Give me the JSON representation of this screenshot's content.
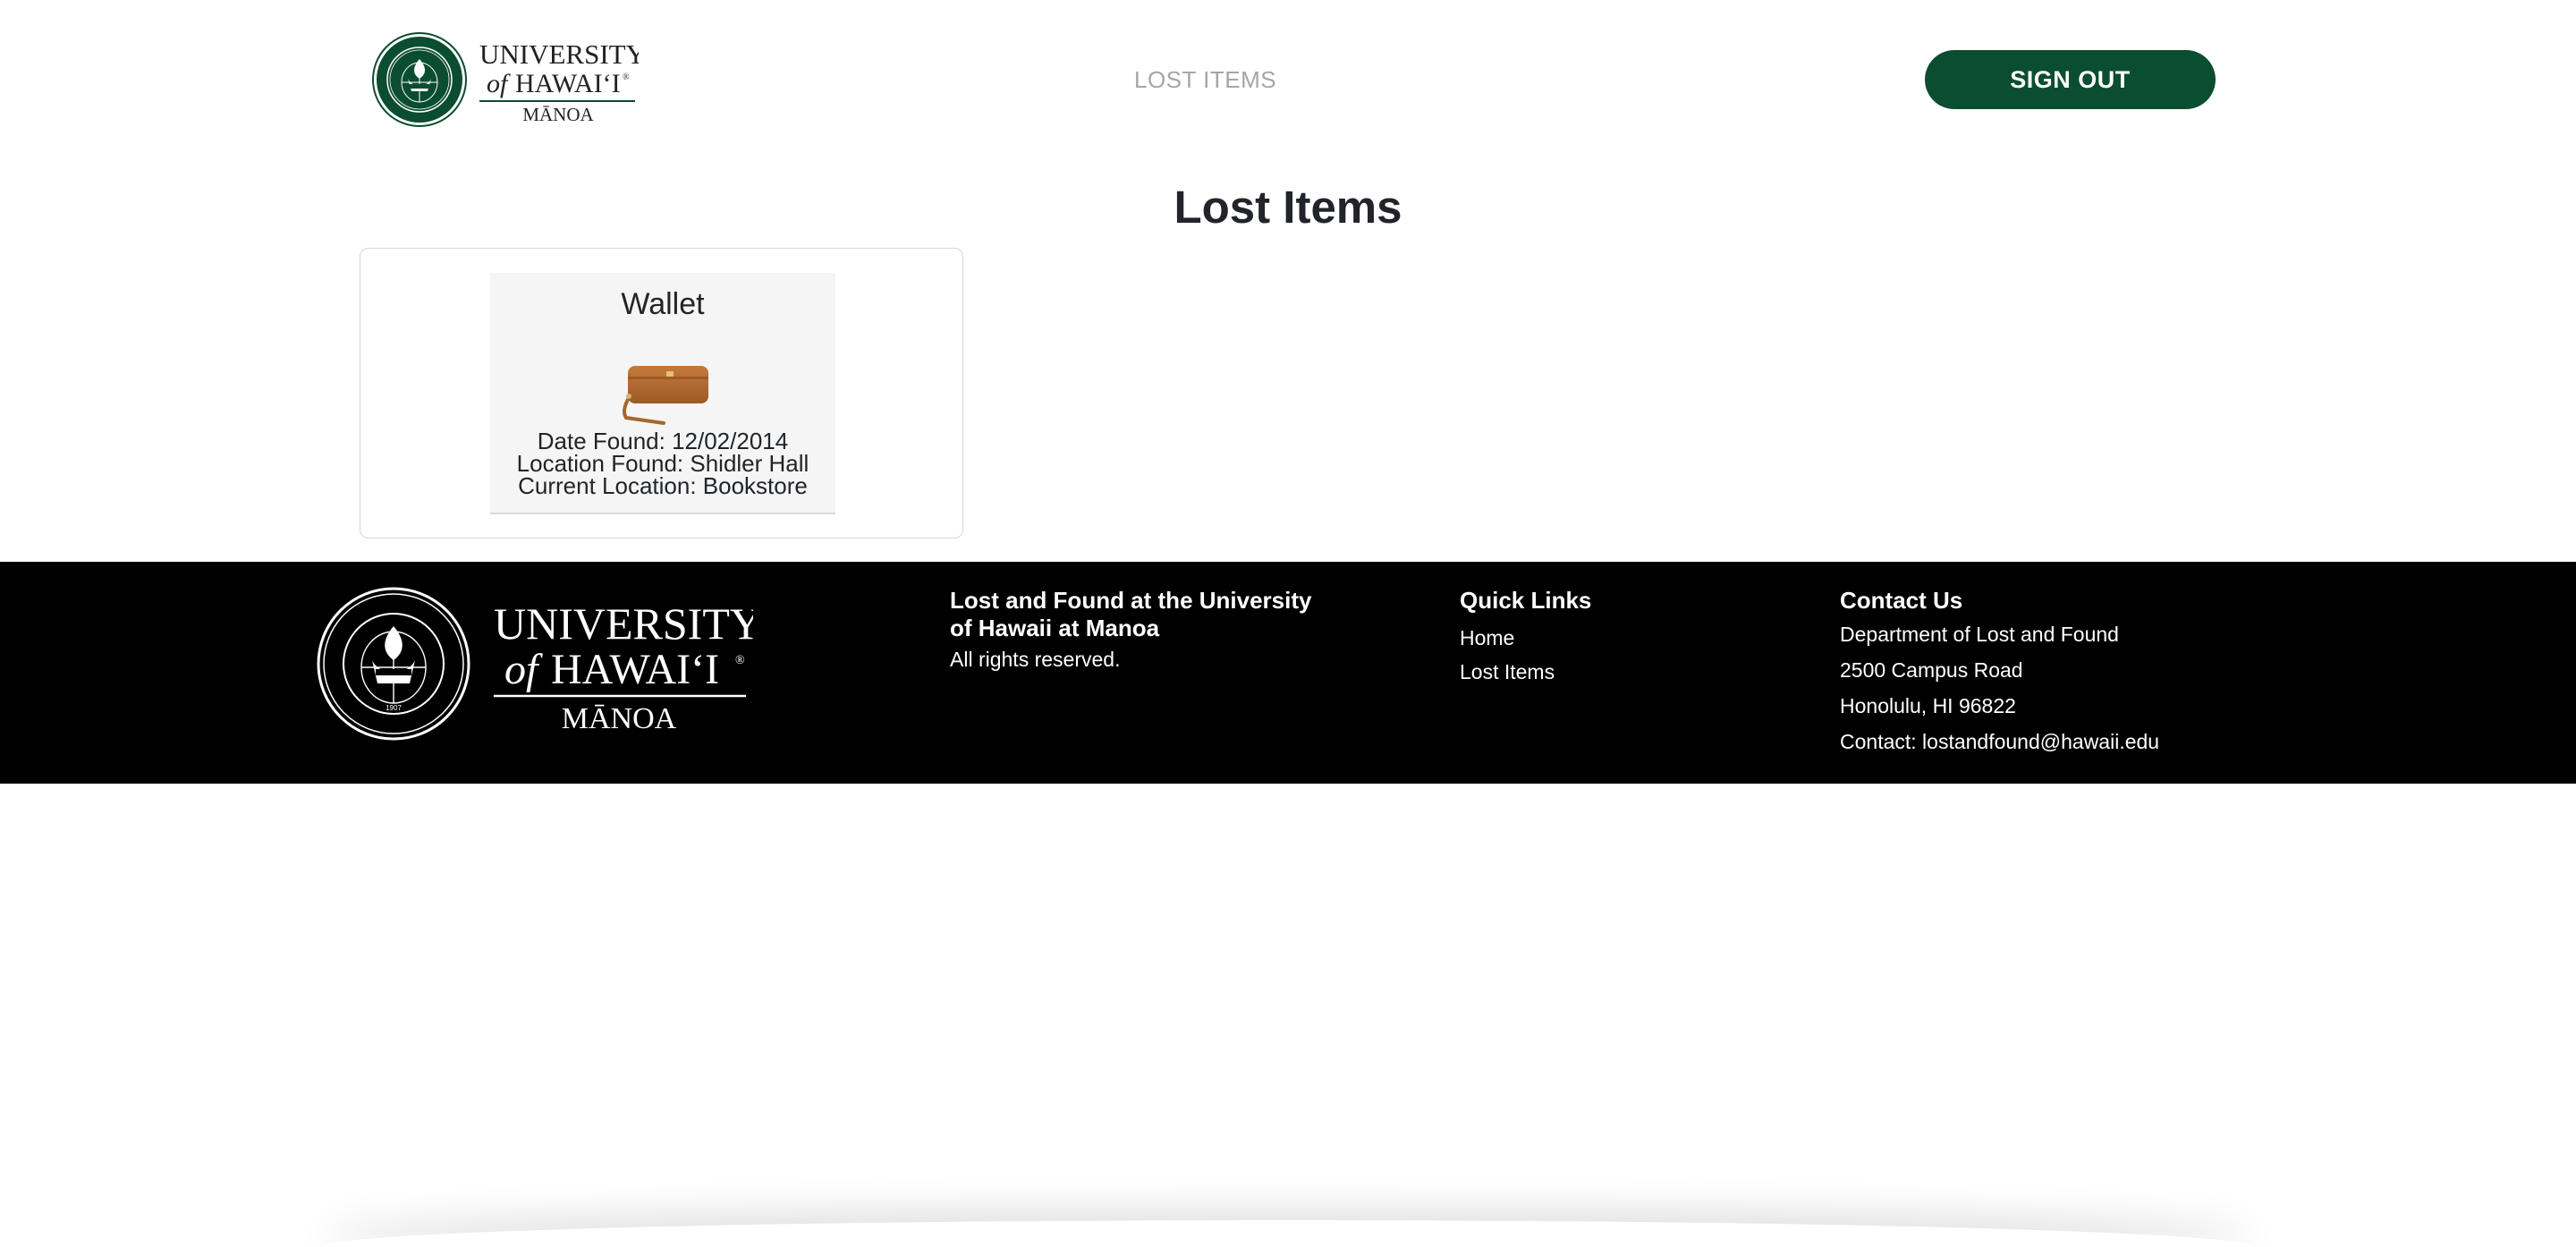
{
  "header": {
    "logo": {
      "line1": "UNIVERSITY",
      "line2": "of HAWAI‘I",
      "line3": "MĀNOA",
      "seal_icon": "uh-seal-green-icon"
    },
    "nav_link": "LOST ITEMS",
    "signout_label": "SIGN OUT",
    "brand_color": "#0b4d31"
  },
  "main": {
    "title": "Lost Items",
    "items": [
      {
        "name": "Wallet",
        "image_icon": "wallet-icon",
        "date_found": "Date Found: 12/02/2014",
        "location_found": "Location Found: Shidler Hall",
        "current_location": "Current Location: Bookstore"
      }
    ]
  },
  "footer": {
    "logo": {
      "line1": "UNIVERSITY",
      "line2": "of HAWAI‘I",
      "line3": "MĀNOA",
      "seal_icon": "uh-seal-white-icon"
    },
    "about_title": "Lost and Found at the University of Hawaii at Manoa",
    "rights": "All rights reserved.",
    "quick_links_title": "Quick Links",
    "quick_links": [
      "Home",
      "Lost Items"
    ],
    "contact_title": "Contact Us",
    "contact_lines": [
      "Department of Lost and Found",
      "2500 Campus Road",
      "Honolulu, HI 96822",
      "Contact: lostandfound@hawaii.edu"
    ]
  }
}
